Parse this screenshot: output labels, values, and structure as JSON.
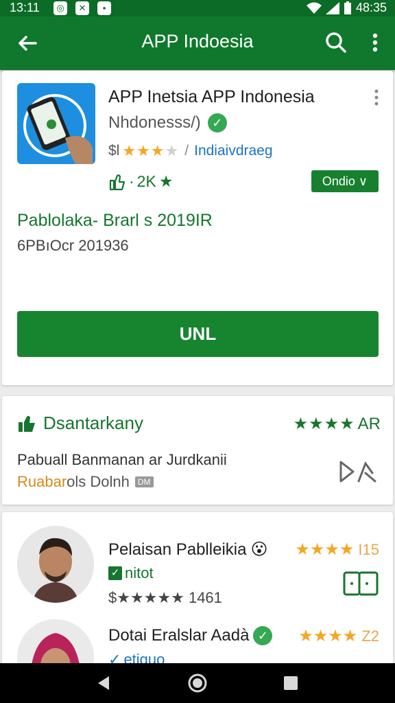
{
  "status_bar": {
    "time": "13:11",
    "battery": "48:35",
    "left_icons": [
      "location-icon",
      "call-icon",
      "notification-icon"
    ],
    "right_icons": [
      "wifi-icon",
      "signal-icon",
      "battery-icon"
    ]
  },
  "appbar": {
    "title": "APP Indoesia",
    "back_icon": "arrow-back-icon",
    "search_icon": "search-icon",
    "more_icon": "more-vert-icon"
  },
  "app_card": {
    "title": "APP Inetsia APP Indonesia",
    "developer": "Nhdonesss/)",
    "rating_prefix": "$l",
    "stars": 3,
    "category": "Indiaivdraeg",
    "downloads": "2K",
    "install_label": "Ondio ∨",
    "headline": "Pablolaka- Brarl s 2019IR",
    "subline": "6PBıOcr 201936",
    "main_button": "UNL"
  },
  "recommendation": {
    "title": "Dsantarkany",
    "rating_label": "AR",
    "stars": 4,
    "description": "Pabuall Banmanan ar Jurdkanii",
    "sub_primary": "Ruabar",
    "sub_secondary": "ols Dolnh",
    "chip": "DM"
  },
  "reviews": [
    {
      "name": "Pelaisan Pablleikia",
      "emoji": "😮",
      "stars": 4,
      "count": "I15",
      "tag": "nitot",
      "line": "$★★★★★ 1461"
    },
    {
      "name": "Dotai Eralslar Aadà",
      "stars": 4,
      "count": "Z2",
      "tag": "etiquo"
    }
  ],
  "colors": {
    "primary": "#10782c",
    "accent": "#178530",
    "star": "#f5a623",
    "link": "#1a73c8"
  }
}
